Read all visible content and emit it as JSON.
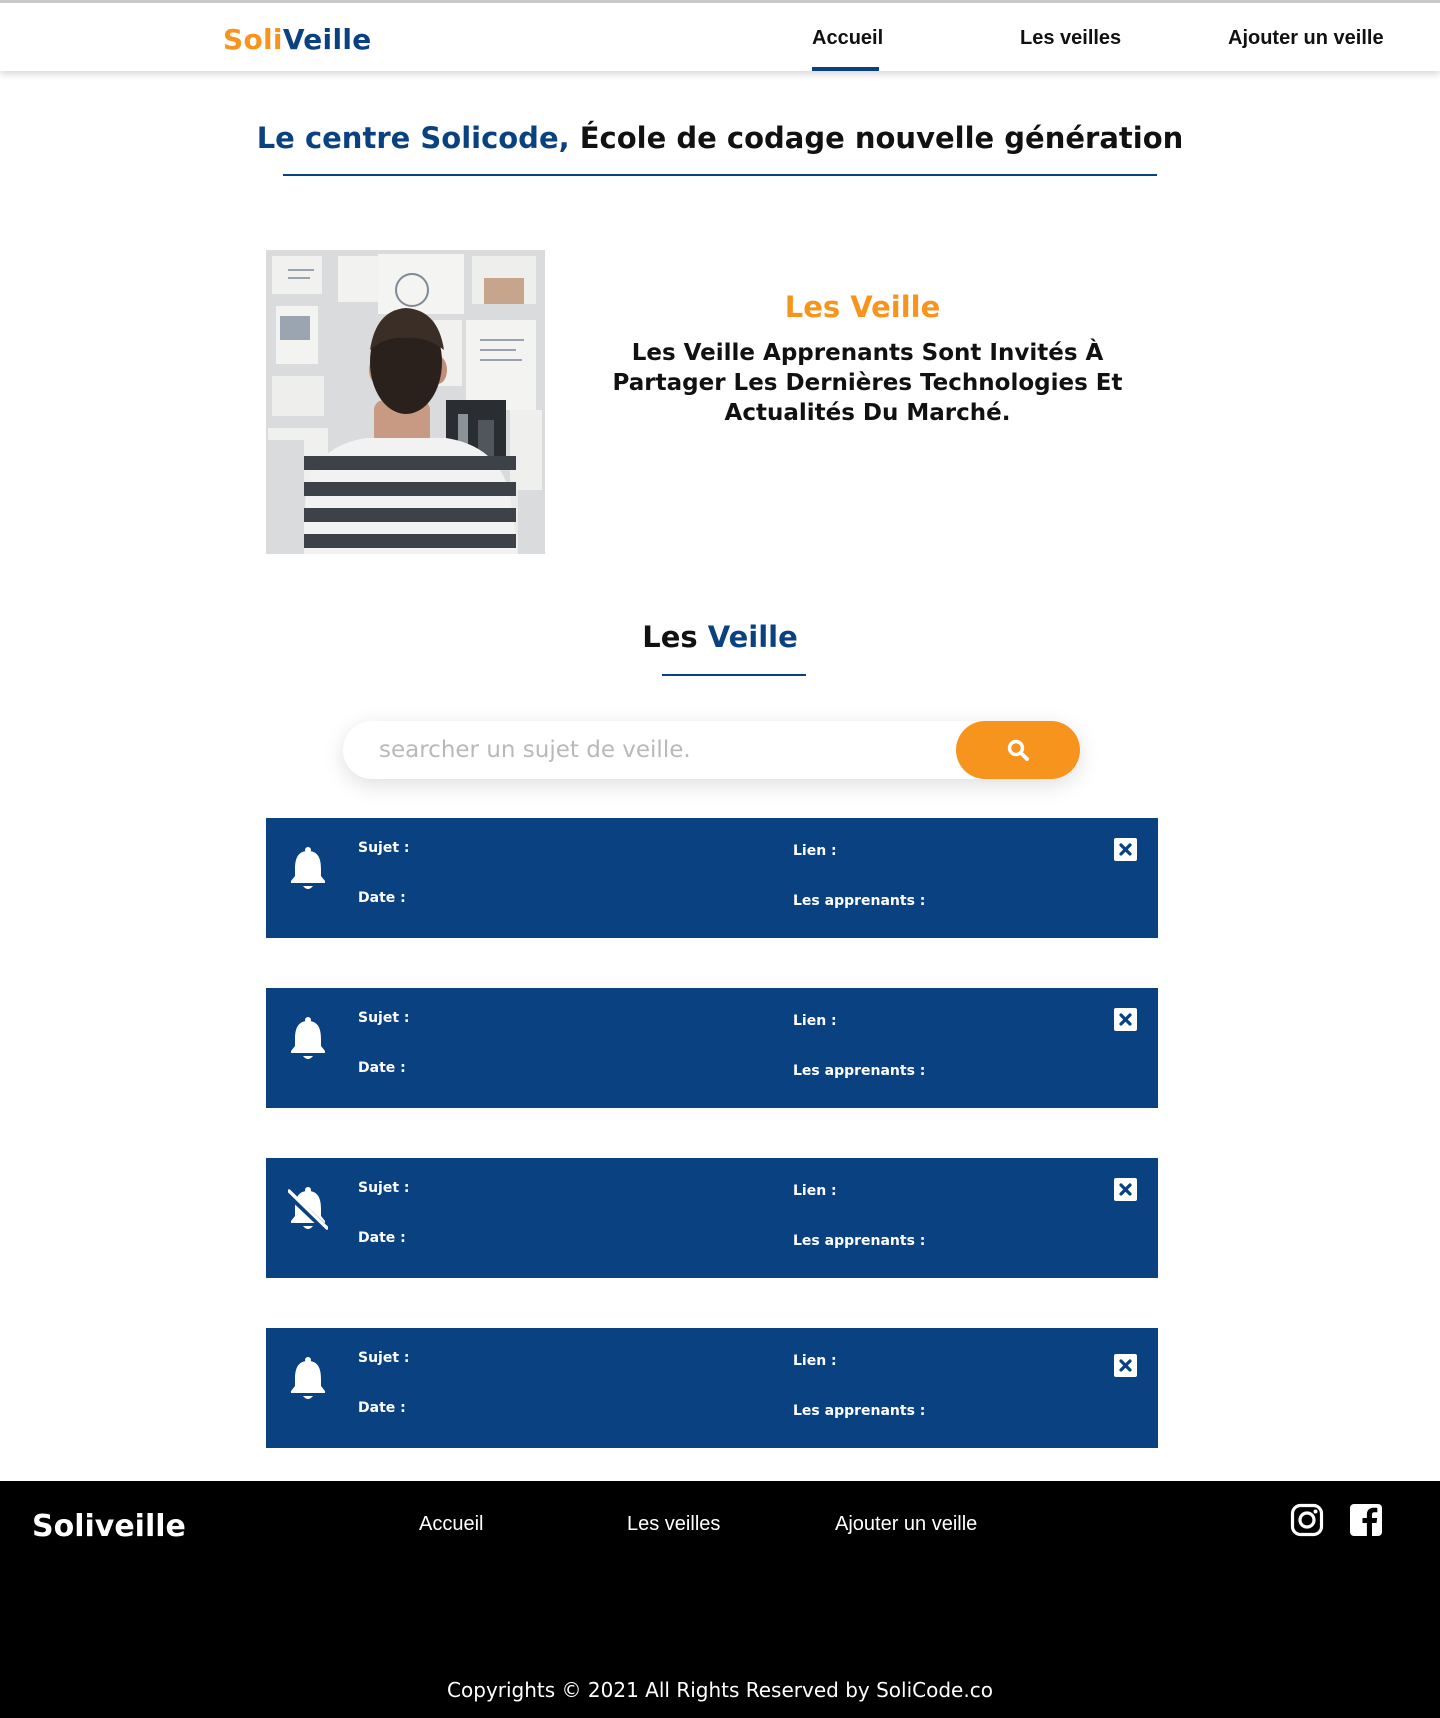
{
  "header": {
    "logo_part1": "Soli",
    "logo_part2": "Veille",
    "nav": [
      {
        "label": "Accueil",
        "active": true
      },
      {
        "label": "Les veilles",
        "active": false
      },
      {
        "label": "Ajouter un veille",
        "active": false
      }
    ]
  },
  "hero": {
    "title_highlight": "Le centre Solicode,",
    "title_rest": " École de codage nouvelle génération"
  },
  "intro": {
    "title": "Les Veille",
    "text": "Les Veille Apprenants Sont Invités À Partager Les Dernières Technologies Et Actualités Du Marché."
  },
  "section": {
    "title_prefix": "Les ",
    "title_highlight": "Veille"
  },
  "search": {
    "placeholder": "searcher un sujet de veille.",
    "value": ""
  },
  "labels": {
    "sujet": "Sujet :",
    "date": "Date :",
    "lien": "Lien :",
    "apprenants": "Les apprenants  :"
  },
  "veilles": [
    {
      "icon": "bell-icon"
    },
    {
      "icon": "bell-icon"
    },
    {
      "icon": "bell-slash-icon"
    },
    {
      "icon": "bell-icon"
    }
  ],
  "footer": {
    "logo": "Soliveille",
    "links": [
      "Accueil",
      "Les veilles",
      "Ajouter un veille"
    ],
    "social": [
      "instagram-icon",
      "facebook-icon"
    ],
    "copyright": "Copyrights © 2021 All Rights Reserved by SoliCode.co"
  },
  "colors": {
    "primary_blue": "#0a4180",
    "accent_orange": "#f7941d",
    "footer_bg": "#000000"
  }
}
